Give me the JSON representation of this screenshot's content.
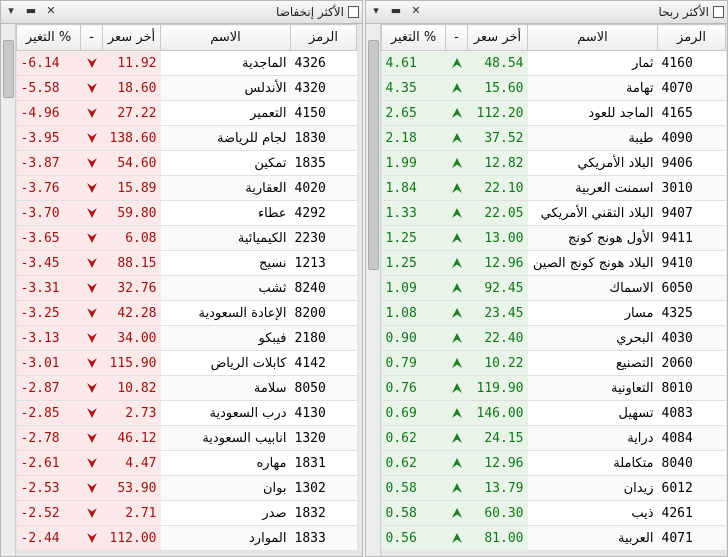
{
  "left_panel": {
    "title": "الأكثر إنخفاضا",
    "controls": [
      "▾",
      "▬",
      "✕"
    ],
    "direction": "down",
    "colors": {
      "value": "#9b1010",
      "arrow": "#b01818",
      "bg": "#fbe9e9"
    },
    "arrow_icon": "down-arrow-icon",
    "headers": {
      "change": "التغير %",
      "arrow": "-",
      "price": "أخر سعر",
      "name": "الاسم",
      "symbol": "الرمز"
    },
    "rows": [
      {
        "change": "-6.14",
        "price": "11.92",
        "name": "الماجدية",
        "symbol": "4326"
      },
      {
        "change": "-5.58",
        "price": "18.60",
        "name": "الأندلس",
        "symbol": "4320"
      },
      {
        "change": "-4.96",
        "price": "27.22",
        "name": "التعمير",
        "symbol": "4150"
      },
      {
        "change": "-3.95",
        "price": "138.60",
        "name": "لجام للرياضة",
        "symbol": "1830"
      },
      {
        "change": "-3.87",
        "price": "54.60",
        "name": "تمكين",
        "symbol": "1835"
      },
      {
        "change": "-3.76",
        "price": "15.89",
        "name": "العقارية",
        "symbol": "4020"
      },
      {
        "change": "-3.70",
        "price": "59.80",
        "name": "عطاء",
        "symbol": "4292"
      },
      {
        "change": "-3.65",
        "price": "6.08",
        "name": "الكيميائية",
        "symbol": "2230"
      },
      {
        "change": "-3.45",
        "price": "88.15",
        "name": "نسيج",
        "symbol": "1213"
      },
      {
        "change": "-3.31",
        "price": "32.76",
        "name": "ثشب",
        "symbol": "8240"
      },
      {
        "change": "-3.25",
        "price": "42.28",
        "name": "الإعادة السعودية",
        "symbol": "8200"
      },
      {
        "change": "-3.13",
        "price": "34.00",
        "name": "فيبكو",
        "symbol": "2180"
      },
      {
        "change": "-3.01",
        "price": "115.90",
        "name": "كابلات الرياض",
        "symbol": "4142"
      },
      {
        "change": "-2.87",
        "price": "10.82",
        "name": "سلامة",
        "symbol": "8050"
      },
      {
        "change": "-2.85",
        "price": "2.73",
        "name": "درب السعودية",
        "symbol": "4130"
      },
      {
        "change": "-2.78",
        "price": "46.12",
        "name": "انابيب السعودية",
        "symbol": "1320"
      },
      {
        "change": "-2.61",
        "price": "4.47",
        "name": "مهاره",
        "symbol": "1831"
      },
      {
        "change": "-2.53",
        "price": "53.90",
        "name": "بوان",
        "symbol": "1302"
      },
      {
        "change": "-2.52",
        "price": "2.71",
        "name": "صدر",
        "symbol": "1832"
      },
      {
        "change": "-2.44",
        "price": "112.00",
        "name": "الموارد",
        "symbol": "1833"
      }
    ]
  },
  "right_panel": {
    "title": "الأكثر ربحا",
    "controls": [
      "▾",
      "▬",
      "✕"
    ],
    "direction": "up",
    "colors": {
      "value": "#13751a",
      "arrow": "#1e7d26",
      "bg": "#e8f4e8"
    },
    "arrow_icon": "up-arrow-icon",
    "headers": {
      "change": "التغير %",
      "arrow": "-",
      "price": "أخر سعر",
      "name": "الاسم",
      "symbol": "الرمز"
    },
    "rows": [
      {
        "change": "4.61",
        "price": "48.54",
        "name": "ثمار",
        "symbol": "4160"
      },
      {
        "change": "4.35",
        "price": "15.60",
        "name": "تهامة",
        "symbol": "4070"
      },
      {
        "change": "2.65",
        "price": "112.20",
        "name": "الماجد للعود",
        "symbol": "4165"
      },
      {
        "change": "2.18",
        "price": "37.52",
        "name": "طيبة",
        "symbol": "4090"
      },
      {
        "change": "1.99",
        "price": "12.82",
        "name": "البلاد الأمريكي",
        "symbol": "9406"
      },
      {
        "change": "1.84",
        "price": "22.10",
        "name": "اسمنت العربية",
        "symbol": "3010"
      },
      {
        "change": "1.33",
        "price": "22.05",
        "name": "البلاد التقني الأمريكي",
        "symbol": "9407"
      },
      {
        "change": "1.25",
        "price": "13.00",
        "name": "الأول هونج كونج",
        "symbol": "9411"
      },
      {
        "change": "1.25",
        "price": "12.96",
        "name": "البلاد هونج كونج الصين",
        "symbol": "9410"
      },
      {
        "change": "1.09",
        "price": "92.45",
        "name": "الاسماك",
        "symbol": "6050"
      },
      {
        "change": "1.08",
        "price": "23.45",
        "name": "مسار",
        "symbol": "4325"
      },
      {
        "change": "0.90",
        "price": "22.40",
        "name": "البحري",
        "symbol": "4030"
      },
      {
        "change": "0.79",
        "price": "10.22",
        "name": "التصنيع",
        "symbol": "2060"
      },
      {
        "change": "0.76",
        "price": "119.90",
        "name": "التعاونية",
        "symbol": "8010"
      },
      {
        "change": "0.69",
        "price": "146.00",
        "name": "تسهيل",
        "symbol": "4083"
      },
      {
        "change": "0.62",
        "price": "24.15",
        "name": "دراية",
        "symbol": "4084"
      },
      {
        "change": "0.62",
        "price": "12.96",
        "name": "متكاملة",
        "symbol": "8040"
      },
      {
        "change": "0.58",
        "price": "13.79",
        "name": "زيدان",
        "symbol": "6012"
      },
      {
        "change": "0.58",
        "price": "60.30",
        "name": "ذيب",
        "symbol": "4261"
      },
      {
        "change": "0.56",
        "price": "81.00",
        "name": "العربية",
        "symbol": "4071"
      }
    ]
  }
}
